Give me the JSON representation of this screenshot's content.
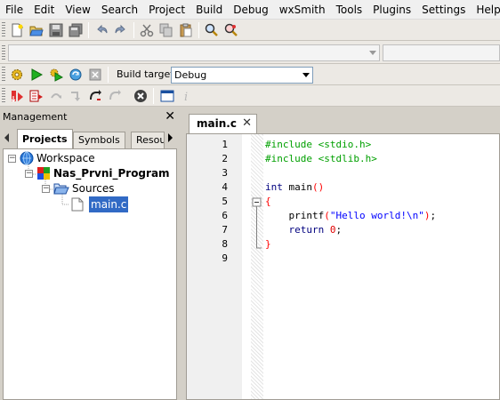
{
  "menu": [
    "File",
    "Edit",
    "View",
    "Search",
    "Project",
    "Build",
    "Debug",
    "wxSmith",
    "Tools",
    "Plugins",
    "Settings",
    "Help"
  ],
  "toolbar": {
    "build_target_label": "Build target:",
    "build_target_value": "Debug"
  },
  "management": {
    "title": "Management",
    "close": "✕",
    "tabs": [
      "Projects",
      "Symbols",
      "Resou"
    ],
    "tree": {
      "workspace": "Workspace",
      "project": "Nas_Prvni_Program",
      "folder": "Sources",
      "file": "main.c"
    }
  },
  "editor": {
    "tab_label": "main.c",
    "tab_close": "✕",
    "line_numbers": [
      "1",
      "2",
      "3",
      "4",
      "5",
      "6",
      "7",
      "8",
      "9"
    ],
    "fold_markers": [
      "⊟"
    ]
  },
  "colors": {
    "preprocessor": "#00a000",
    "keyword": "#00007f",
    "string": "#0000ff",
    "number": "#e00000",
    "selection": "#316ac5"
  }
}
